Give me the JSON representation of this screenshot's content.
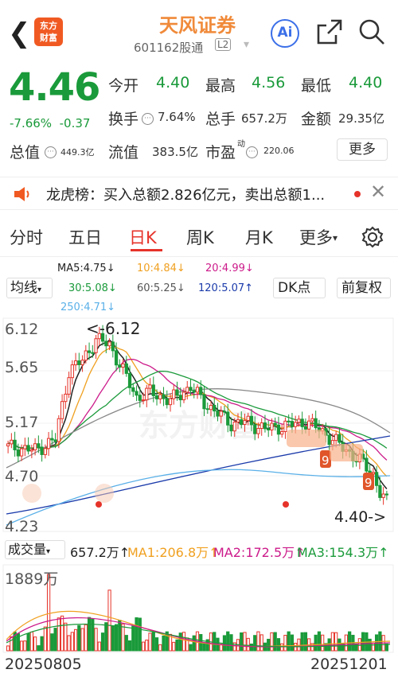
{
  "header": {
    "back_icon": "chevron-left-icon",
    "logo_line1": "东方",
    "logo_line2": "财富",
    "title": "天风证券",
    "code": "601162股通",
    "level": "L2",
    "ai_label": "Ai"
  },
  "quote": {
    "price": "4.46",
    "change_pct": "-7.66%",
    "change_amt": "-0.37",
    "open_label": "今开",
    "open": "4.40",
    "high_label": "最高",
    "high": "4.56",
    "low_label": "最低",
    "low": "4.40",
    "turnover_label": "换手",
    "turnover": "7.64%",
    "volume_label": "总手",
    "volume": "657.2万",
    "amount_label": "金额",
    "amount": "29.35亿",
    "mktcap_label": "总值",
    "mktcap": "449.3亿",
    "float_label": "流值",
    "float": "383.5亿",
    "pe_label": "市盈",
    "pe_sup": "动",
    "pe": "220.06",
    "more_label": "更多"
  },
  "dragon": {
    "text": "龙虎榜：买入总额2.826亿元，卖出总额1..."
  },
  "tabs": [
    {
      "label": "分时"
    },
    {
      "label": "五日"
    },
    {
      "label": "日K"
    },
    {
      "label": "周K"
    },
    {
      "label": "月K"
    },
    {
      "label": "更多"
    }
  ],
  "ma_controls": {
    "junxian": "均线",
    "dk": "DK点",
    "fuquan": "前复权"
  },
  "ma_values": {
    "ma5": "MA5:4.75↓",
    "ma10": "10:4.84↓",
    "ma20": "20:4.99↓",
    "ma30": "30:5.08↓",
    "ma60": "60:5.25↓",
    "ma120": "120:5.07↑",
    "ma250": "250:4.71↓"
  },
  "colors": {
    "up": "#e6332a",
    "down": "#1a9a3a",
    "ma5": "#222222",
    "ma10": "#f0a020",
    "ma20": "#cc1a8a",
    "ma30": "#1a9a3a",
    "ma60": "#888888",
    "ma120": "#1a3aaa",
    "ma250": "#5ab0e8"
  },
  "chart_data": {
    "type": "candlestick",
    "yticks": [
      "6.12",
      "5.65",
      "5.17",
      "4.70",
      "4.23"
    ],
    "high_marker": "<-6.12",
    "low_marker": "4.40->",
    "volume_max_label": "1889万",
    "volume": "657.2万↑",
    "vol_ma1": "MA1:206.8万↑",
    "vol_ma2": "MA2:172.5万↑",
    "vol_ma3": "MA3:154.3万↑",
    "volume_label": "成交量",
    "date_start": "20250805",
    "date_end": "20251201",
    "watermark": "东方财富"
  }
}
